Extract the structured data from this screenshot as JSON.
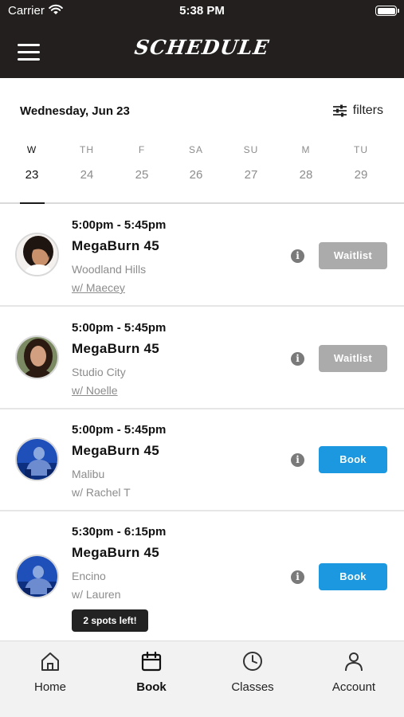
{
  "status_bar": {
    "carrier": "Carrier",
    "time": "5:38 PM"
  },
  "header": {
    "title": "SCHEDULE",
    "menu_icon": "hamburger-menu-icon"
  },
  "date_bar": {
    "selected_date": "Wednesday, Jun 23",
    "filters_label": "filters",
    "filters_icon": "sliders-icon",
    "days": [
      {
        "dow": "W",
        "num": "23",
        "selected": true
      },
      {
        "dow": "TH",
        "num": "24",
        "selected": false
      },
      {
        "dow": "F",
        "num": "25",
        "selected": false
      },
      {
        "dow": "SA",
        "num": "26",
        "selected": false
      },
      {
        "dow": "SU",
        "num": "27",
        "selected": false
      },
      {
        "dow": "M",
        "num": "28",
        "selected": false
      },
      {
        "dow": "TU",
        "num": "29",
        "selected": false
      }
    ]
  },
  "classes": [
    {
      "time": "5:00pm - 5:45pm",
      "name": "MegaBurn 45",
      "location": "Woodland Hills",
      "instructor": "w/ Maecey",
      "action": "Waitlist"
    },
    {
      "time": "5:00pm - 5:45pm",
      "name": "MegaBurn 45",
      "location": "Studio City",
      "instructor": "w/ Noelle",
      "action": "Waitlist"
    },
    {
      "time": "5:00pm - 5:45pm",
      "name": "MegaBurn 45",
      "location": "Malibu",
      "instructor": "w/ Rachel T",
      "action": "Book"
    },
    {
      "time": "5:30pm - 6:15pm",
      "name": "MegaBurn 45",
      "location": "Encino",
      "instructor": "w/ Lauren",
      "action": "Book",
      "badge": "2 spots left!"
    }
  ],
  "tabbar": {
    "items": [
      {
        "label": "Home",
        "icon": "home-icon",
        "active": false
      },
      {
        "label": "Book",
        "icon": "calendar-icon",
        "active": true
      },
      {
        "label": "Classes",
        "icon": "clock-icon",
        "active": false
      },
      {
        "label": "Account",
        "icon": "person-icon",
        "active": false
      }
    ]
  },
  "colors": {
    "header_bg": "#221f1e",
    "book_blue": "#1b98e0",
    "waitlist_gray": "#ababab"
  }
}
